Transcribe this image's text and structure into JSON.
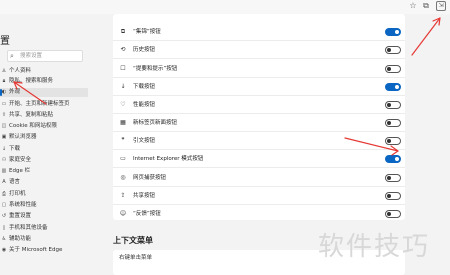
{
  "toolbar": {
    "icons": [
      "favorites-icon",
      "collections-icon",
      "extensions-icon"
    ]
  },
  "sidebar": {
    "title": "置",
    "search_placeholder": "搜索设置",
    "items": [
      {
        "icon": "profile-icon",
        "label": "个人资料"
      },
      {
        "icon": "lock-icon",
        "label": "隐私、搜索和服务"
      },
      {
        "icon": "appearance-icon",
        "label": "外观",
        "selected": true
      },
      {
        "icon": "window-icon",
        "label": "开始、主页和新建标签页"
      },
      {
        "icon": "share-icon",
        "label": "共享、复制和粘贴"
      },
      {
        "icon": "cookie-icon",
        "label": "Cookie 和网站权限"
      },
      {
        "icon": "browser-icon",
        "label": "默认浏览器"
      },
      {
        "icon": "download-icon",
        "label": "下载"
      },
      {
        "icon": "family-icon",
        "label": "家庭安全"
      },
      {
        "icon": "edge-bar-icon",
        "label": "Edge 栏"
      },
      {
        "icon": "language-icon",
        "label": "语言"
      },
      {
        "icon": "printer-icon",
        "label": "打印机"
      },
      {
        "icon": "system-icon",
        "label": "系统和性能"
      },
      {
        "icon": "reset-icon",
        "label": "重置设置"
      },
      {
        "icon": "phone-icon",
        "label": "手机和其他设备"
      },
      {
        "icon": "accessibility-icon",
        "label": "辅助功能"
      },
      {
        "icon": "edge-icon",
        "label": "关于 Microsoft Edge"
      }
    ]
  },
  "toolbar_buttons": [
    {
      "icon": "collections-icon",
      "label": "“集锦”按钮",
      "on": true
    },
    {
      "icon": "history-icon",
      "label": "历史按钮",
      "on": false
    },
    {
      "icon": "tips-icon",
      "label": "“提要和提示”按钮",
      "on": false
    },
    {
      "icon": "download-icon",
      "label": "下载按钮",
      "on": true
    },
    {
      "icon": "performance-icon",
      "label": "性能按钮",
      "on": false
    },
    {
      "icon": "new-tab-icon",
      "label": "新标签页新面按钮",
      "on": false
    },
    {
      "icon": "quote-icon",
      "label": "引文按钮",
      "on": false
    },
    {
      "icon": "ie-icon",
      "label": "Internet Explorer 模式按钮",
      "on": true
    },
    {
      "icon": "web-capture-icon",
      "label": "网页捕获按钮",
      "on": false
    },
    {
      "icon": "share-icon",
      "label": "共享按钮",
      "on": false
    },
    {
      "icon": "feedback-icon",
      "label": "“反馈”按钮",
      "on": false
    }
  ],
  "context_menu": {
    "title": "上下文菜单",
    "first_item": "右键单击菜单"
  },
  "watermark": "软件技巧",
  "colors": {
    "accent": "#0a66c2",
    "annotation": "#e53935"
  }
}
